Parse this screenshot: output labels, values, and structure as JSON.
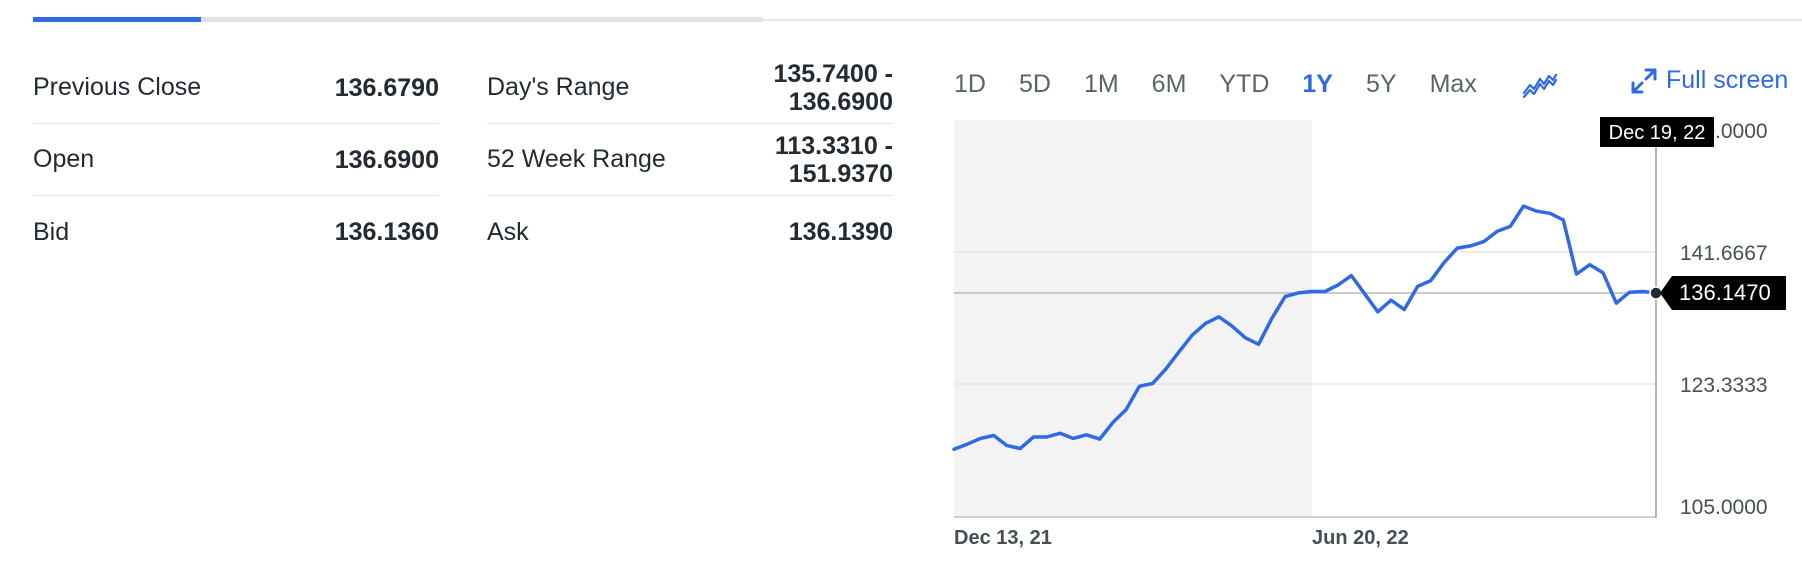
{
  "quote_summary": {
    "left": [
      {
        "label": "Previous Close",
        "value": "136.6790"
      },
      {
        "label": "Open",
        "value": "136.6900"
      },
      {
        "label": "Bid",
        "value": "136.1360"
      }
    ],
    "right": [
      {
        "label": "Day's Range",
        "value_line1": "135.7400 -",
        "value_line2": "136.6900"
      },
      {
        "label": "52 Week Range",
        "value_line1": "113.3310 -",
        "value_line2": "151.9370"
      },
      {
        "label": "Ask",
        "value_line1": "136.1390",
        "value_line2": ""
      }
    ]
  },
  "range_tabs": [
    "1D",
    "5D",
    "1M",
    "6M",
    "YTD",
    "1Y",
    "5Y",
    "Max"
  ],
  "active_range": "1Y",
  "full_screen_label": "Full screen",
  "icons": {
    "chart_type": "line-chart-icon",
    "full_screen": "expand-arrows-icon"
  },
  "colors": {
    "accent": "#2f6ae3",
    "line": "#2f6ae3",
    "text": "#232a31",
    "tooltip_bg": "#000000",
    "shade": "#f3f3f3"
  },
  "chart_data": {
    "type": "line",
    "y_ticks": [
      "160.0000",
      "141.6667",
      "123.3333",
      "105.0000"
    ],
    "ylim": [
      105,
      160
    ],
    "x_labels": [
      "Dec 13, 21",
      "Jun 20, 22"
    ],
    "hover_date": "Dec 19, 22",
    "current_value": "136.1470",
    "current_value_num": 136.147,
    "series": [
      {
        "values": [
          114.5,
          115.2,
          116.0,
          116.4,
          115.0,
          114.6,
          116.2,
          116.2,
          116.7,
          116.0,
          116.5,
          115.9,
          118.2,
          120.0,
          123.2,
          123.6,
          125.6,
          128.0,
          130.3,
          131.9,
          132.8,
          131.5,
          129.9,
          129.0,
          132.6,
          135.6,
          136.1,
          136.3,
          136.3,
          137.2,
          138.5,
          136.0,
          133.5,
          135.1,
          133.8,
          137.0,
          137.8,
          140.3,
          142.3,
          142.6,
          143.2,
          144.6,
          145.3,
          148.1,
          147.4,
          147.1,
          146.2,
          138.7,
          140.0,
          138.9,
          134.7,
          136.2,
          136.3,
          136.1
        ]
      }
    ]
  }
}
